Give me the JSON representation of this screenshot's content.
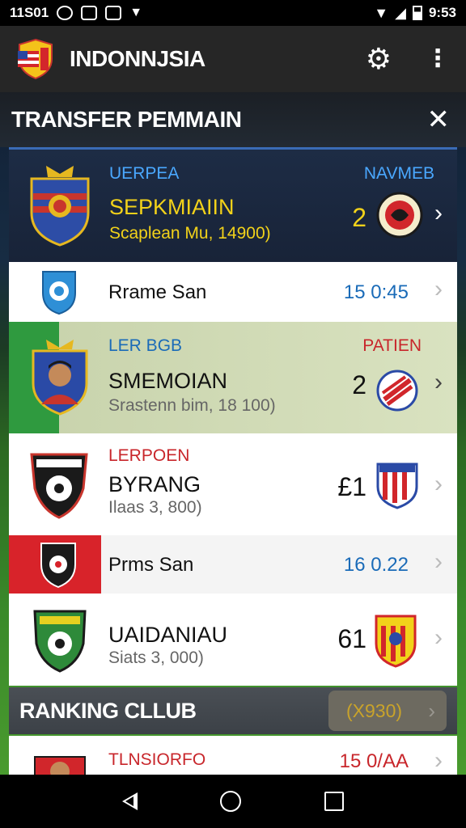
{
  "status_bar": {
    "left_text": "11S01",
    "time": "9:53",
    "icons": [
      "camera-icon",
      "notification-icon",
      "media-icon",
      "vpn-icon",
      "wifi-icon",
      "signal-icon",
      "battery-icon"
    ]
  },
  "app_bar": {
    "title": "INDONNJSIA",
    "icons": [
      "flag-logo",
      "gear-icon",
      "overflow-menu-icon"
    ]
  },
  "transfer_section": {
    "title": "TRANSFER PEMMAIN",
    "close_icon": "close-icon"
  },
  "featured": {
    "label_left": "UERPEA",
    "label_right": "NAVMEB",
    "name": "SEPKMIAIIN",
    "sub": "Scaplean Mu, 14900)",
    "score": "2"
  },
  "rows": [
    {
      "type": "short",
      "name": "Rrame San",
      "time": "15 0:45"
    },
    {
      "type": "tall",
      "label_left": "LER BGB",
      "label_right": "PATIEN",
      "name": "SMEMOIAN",
      "sub": "Srastenn bim, 18 100)",
      "score": "2"
    },
    {
      "type": "tall",
      "label_left": "LERPOEN",
      "name": "BYRANG",
      "sub": "Ilaas 3, 800)",
      "score": "£1"
    },
    {
      "type": "short",
      "name": "Prms San",
      "time": "16 0.22"
    },
    {
      "type": "tall",
      "name": "UAIDANIAU",
      "sub": "Siats 3, 000)",
      "score": "61"
    }
  ],
  "ranking": {
    "title": "RANKING CLLUB",
    "pill": "(X930)"
  },
  "bottom_row": {
    "name": "TLNSIORFO",
    "time": "15 0/AA"
  },
  "nav": {
    "icons": [
      "back-icon",
      "home-icon",
      "recents-icon"
    ]
  }
}
